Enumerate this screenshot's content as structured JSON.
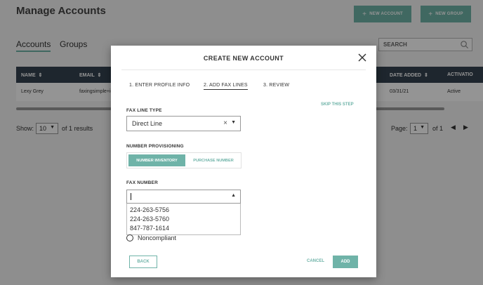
{
  "page": {
    "title": "Manage Accounts",
    "new_account_label": "NEW ACCOUNT",
    "new_group_label": "NEW GROUP",
    "tabs": [
      {
        "label": "Accounts",
        "active": true
      },
      {
        "label": "Groups",
        "active": false
      }
    ],
    "search_placeholder": "SEARCH",
    "table": {
      "columns": [
        "NAME",
        "EMAIL",
        "DATE ADDED",
        "ACTIVATIO"
      ],
      "rows": [
        {
          "name": "Lexy Grey",
          "email": "faxingsimple+ie",
          "date_added": "03/31/21",
          "activation": "Active"
        }
      ]
    },
    "pagination": {
      "show_label": "Show:",
      "page_size": "10",
      "of_label": "of",
      "results_count": "1",
      "results_label": "results",
      "page_label": "Page:",
      "current_page": "1",
      "total_pages": "1"
    }
  },
  "modal": {
    "title": "CREATE NEW ACCOUNT",
    "steps": [
      {
        "label": "1. ENTER PROFILE INFO",
        "active": false
      },
      {
        "label": "2. ADD FAX LINES",
        "active": true
      },
      {
        "label": "3. REVIEW",
        "active": false
      }
    ],
    "skip_label": "SKIP THIS STEP",
    "fax_line_type": {
      "label": "FAX LINE TYPE",
      "value": "Direct Line"
    },
    "number_provisioning": {
      "label": "NUMBER PROVISIONING",
      "options": [
        {
          "label": "NUMBER INVENTORY",
          "active": true
        },
        {
          "label": "PURCHASE NUMBER",
          "active": false
        }
      ]
    },
    "fax_number": {
      "label": "FAX NUMBER",
      "value": "",
      "options": [
        "224-263-5756",
        "224-263-5760",
        "847-787-1614"
      ]
    },
    "radio_label": "Noncompliant",
    "back_label": "BACK",
    "cancel_label": "CANCEL",
    "add_label": "ADD"
  },
  "colors": {
    "accent": "#6fb3a8",
    "table_header": "#354350"
  }
}
